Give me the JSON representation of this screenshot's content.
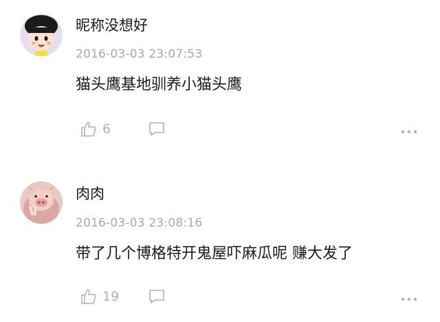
{
  "comments": [
    {
      "username": "昵称没想好",
      "avatar_icon": "cartoon-girl-avatar",
      "timestamp": "2016-03-03 23:07:53",
      "text": "猫头鹰基地驯养小猫头鹰",
      "like_count": "6",
      "like_icon": "thumbs-up-icon",
      "reply_icon": "comment-bubble-icon",
      "more_icon": "more-dots-icon"
    },
    {
      "username": "肉肉",
      "avatar_icon": "pig-photo-avatar",
      "timestamp": "2016-03-03 23:08:16",
      "text": "带了几个博格特开鬼屋吓麻瓜呢 赚大发了",
      "like_count": "19",
      "like_icon": "thumbs-up-icon",
      "reply_icon": "comment-bubble-icon",
      "more_icon": "more-dots-icon"
    }
  ],
  "colors": {
    "text_primary": "#1a1a1a",
    "text_meta": "#a8a8a8",
    "icon_gray": "#b0b0b0"
  }
}
